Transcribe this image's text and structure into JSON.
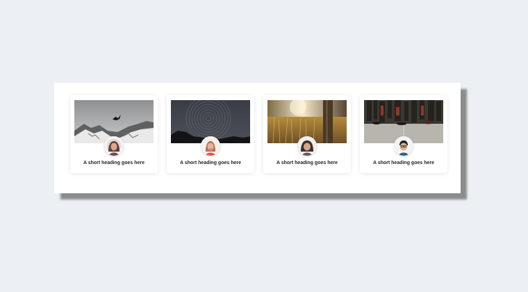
{
  "cards": [
    {
      "heading": "A short heading goes here",
      "image": "snowy-mountains-with-bird",
      "avatar": "woman-avatar"
    },
    {
      "heading": "A short heading goes here",
      "image": "night-sky-star-trails",
      "avatar": "woman-avatar"
    },
    {
      "heading": "A short heading goes here",
      "image": "sunlit-grass-field",
      "avatar": "woman-avatar"
    },
    {
      "heading": "A short heading goes here",
      "image": "crowd-walking-feet",
      "avatar": "man-avatar"
    }
  ]
}
